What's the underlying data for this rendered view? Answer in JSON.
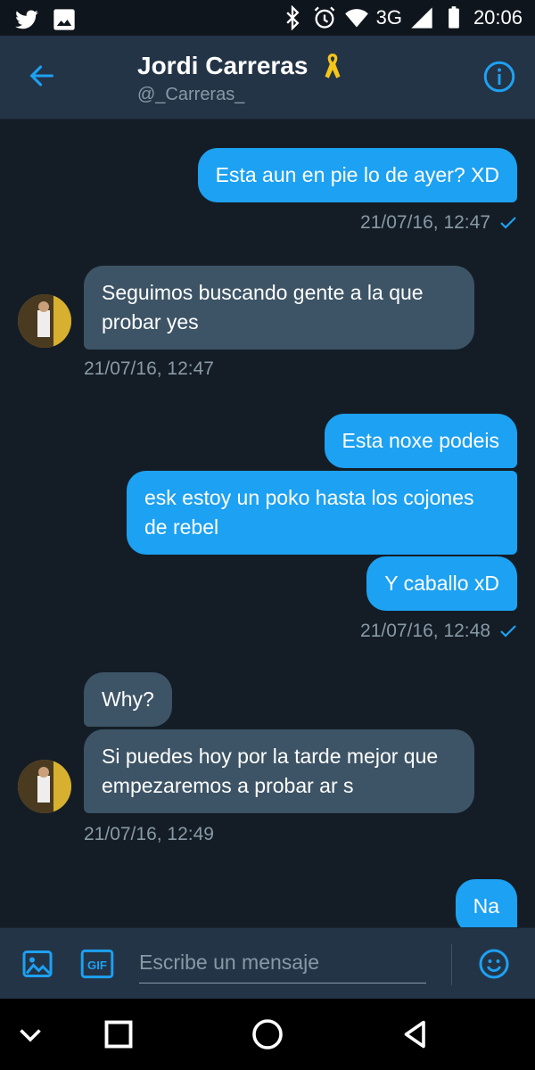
{
  "status_bar": {
    "network": "3G",
    "time": "20:06",
    "icons": [
      "twitter-icon",
      "image-icon",
      "bluetooth-icon",
      "alarm-icon",
      "wifi-icon",
      "signal-icon",
      "battery-icon"
    ]
  },
  "header": {
    "name": "Jordi Carreras",
    "handle": "@_Carreras_",
    "badge_icon": "yellow-ribbon-icon"
  },
  "messages": [
    {
      "dir": "out",
      "text": "Esta aun en pie lo de ayer?  XD"
    },
    {
      "dir": "ts-out",
      "text": "21/07/16, 12:47"
    },
    {
      "dir": "in",
      "text": "Seguimos buscando gente a la que probar yes"
    },
    {
      "dir": "ts-in",
      "text": "21/07/16, 12:47"
    },
    {
      "dir": "out",
      "text": "Esta noxe podeis"
    },
    {
      "dir": "out",
      "text": "esk estoy un poko hasta los cojones de rebel"
    },
    {
      "dir": "out",
      "text": "Y caballo xD"
    },
    {
      "dir": "ts-out",
      "text": "21/07/16, 12:48"
    },
    {
      "dir": "in",
      "text": "Why?"
    },
    {
      "dir": "in",
      "text": "Si puedes hoy por la tarde mejor que empezaremos a probar ar s"
    },
    {
      "dir": "ts-in",
      "text": "21/07/16, 12:49"
    },
    {
      "dir": "out",
      "text": "Na"
    }
  ],
  "composer": {
    "placeholder": "Escribe un mensaje",
    "gif_label": "GIF"
  },
  "colors": {
    "background": "#141d26",
    "header": "#243447",
    "outgoing": "#1da1f2",
    "incoming": "#3d5466",
    "muted": "#8899a6"
  }
}
